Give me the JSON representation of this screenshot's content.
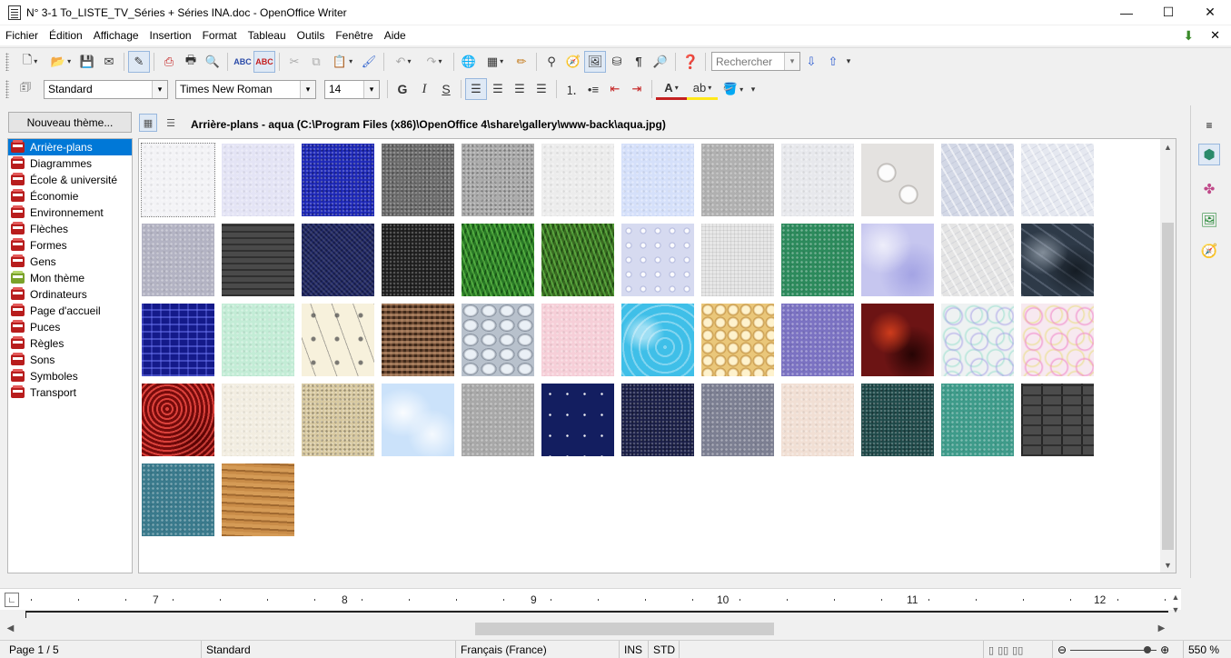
{
  "window": {
    "title": "N° 3-1 To_LISTE_TV_Séries + Séries INA.doc - OpenOffice Writer",
    "minimize": "—",
    "maximize": "☐",
    "close": "✕"
  },
  "menu": {
    "items": [
      "Fichier",
      "Édition",
      "Affichage",
      "Insertion",
      "Format",
      "Tableau",
      "Outils",
      "Fenêtre",
      "Aide"
    ],
    "update_icon": "⬇",
    "close_doc": "✕"
  },
  "toolbar_standard": {
    "search_placeholder": "Rechercher"
  },
  "toolbar_format": {
    "paragraph_style": "Standard",
    "font_name": "Times New Roman",
    "font_size": "14",
    "bold": "G",
    "italic": "I",
    "shadow": "S"
  },
  "gallery": {
    "new_theme_label": "Nouveau thème...",
    "title": "Arrière-plans - aqua (C:\\Program Files (x86)\\OpenOffice 4\\share\\gallery\\www-back\\aqua.jpg)",
    "themes": [
      {
        "label": "Arrière-plans",
        "selected": true
      },
      {
        "label": "Diagrammes"
      },
      {
        "label": "École & université"
      },
      {
        "label": "Économie"
      },
      {
        "label": "Environnement"
      },
      {
        "label": "Flèches"
      },
      {
        "label": "Formes"
      },
      {
        "label": "Gens"
      },
      {
        "label": "Mon thème",
        "green": true
      },
      {
        "label": "Ordinateurs"
      },
      {
        "label": "Page d'accueil"
      },
      {
        "label": "Puces"
      },
      {
        "label": "Règles"
      },
      {
        "label": "Sons"
      },
      {
        "label": "Symboles"
      },
      {
        "label": "Transport"
      }
    ],
    "tiles": [
      {
        "name": "aqua",
        "bg": "#f3f3f6",
        "fx": "speck-light"
      },
      {
        "name": "blizzard",
        "bg": "#e4e4f5",
        "fx": "speck-light"
      },
      {
        "name": "blue-dust",
        "bg": "#1c27b8",
        "fx": "speck-dark"
      },
      {
        "name": "concrete-dark",
        "bg": "#6b6b6b",
        "fx": "speck-dark"
      },
      {
        "name": "concrete-light",
        "bg": "#aaaaaa",
        "fx": "speck-dark"
      },
      {
        "name": "paper-white",
        "bg": "#ececec",
        "fx": "speck-light"
      },
      {
        "name": "ice-blue",
        "bg": "#d5e0fa",
        "fx": "speck-light"
      },
      {
        "name": "grey-sand",
        "bg": "#b0b0b0",
        "fx": "speck-light"
      },
      {
        "name": "clouds-white",
        "bg": "#e7e8ec",
        "fx": "speck-light"
      },
      {
        "name": "paws",
        "bg": "#e4e2e0",
        "fx": "paws"
      },
      {
        "name": "crystal",
        "bg": "#d3d8e6",
        "fx": "streak"
      },
      {
        "name": "frost",
        "bg": "#e5e8f0",
        "fx": "streak"
      },
      {
        "name": "lilac-rough",
        "bg": "#b3b3c3",
        "fx": "speck-light"
      },
      {
        "name": "charcoal",
        "bg": "#4a4a4a",
        "fx": "hline"
      },
      {
        "name": "navy-weave",
        "bg": "#1e2563",
        "fx": "weave"
      },
      {
        "name": "black-grain",
        "bg": "#1f1f1f",
        "fx": "speck-dark"
      },
      {
        "name": "grass",
        "bg": "#2a7a26",
        "fx": "grass"
      },
      {
        "name": "grass-dark",
        "bg": "#3a6b22",
        "fx": "grass"
      },
      {
        "name": "water-drops",
        "bg": "#d6daf0",
        "fx": "drops"
      },
      {
        "name": "canvas-white",
        "bg": "#e7e7e7",
        "fx": "weave-light"
      },
      {
        "name": "green-felt",
        "bg": "#2c8a5c",
        "fx": "speck-light"
      },
      {
        "name": "lavender-marble",
        "bg": "#c6c6ef",
        "fx": "marble"
      },
      {
        "name": "white-marble",
        "bg": "#e4e4e4",
        "fx": "streak"
      },
      {
        "name": "blue-marble",
        "bg": "#2e3a48",
        "fx": "marble-dark"
      },
      {
        "name": "blue-maze",
        "bg": "#141a8a",
        "fx": "maze"
      },
      {
        "name": "mint",
        "bg": "#c3ecd6",
        "fx": "speck-light"
      },
      {
        "name": "music-notes",
        "bg": "#f7f1dc",
        "fx": "notes"
      },
      {
        "name": "basket-weave",
        "bg": "#6a4832",
        "fx": "basket"
      },
      {
        "name": "stones",
        "bg": "#b8c1cc",
        "fx": "stones"
      },
      {
        "name": "pink",
        "bg": "#f6cfd8",
        "fx": "speck-light"
      },
      {
        "name": "pool-water",
        "bg": "#3fbfe8",
        "fx": "water"
      },
      {
        "name": "popcorn",
        "bg": "#eac77a",
        "fx": "popcorn"
      },
      {
        "name": "violet",
        "bg": "#7b72c2",
        "fx": "speck-light"
      },
      {
        "name": "red-lava",
        "bg": "#6c1414",
        "fx": "lava"
      },
      {
        "name": "rings-pastel",
        "bg": "#eef2f2",
        "fx": "rings"
      },
      {
        "name": "rings-pink",
        "bg": "#f7e9f0",
        "fx": "rings-pink"
      },
      {
        "name": "roses",
        "bg": "#a51c1c",
        "fx": "roses"
      },
      {
        "name": "cream",
        "bg": "#f2ede1",
        "fx": "speck-light"
      },
      {
        "name": "sand",
        "bg": "#d8c9a0",
        "fx": "speck-dark"
      },
      {
        "name": "sky",
        "bg": "#cbe2fa",
        "fx": "sky"
      },
      {
        "name": "stucco-grey",
        "bg": "#a8a8a8",
        "fx": "speck-light"
      },
      {
        "name": "starry-night",
        "bg": "#131e60",
        "fx": "stars"
      },
      {
        "name": "navy-stucco",
        "bg": "#1a1f48",
        "fx": "speck-dark"
      },
      {
        "name": "slate-stucco",
        "bg": "#7c7f92",
        "fx": "speck-light"
      },
      {
        "name": "peach",
        "bg": "#f1dfd4",
        "fx": "speck-light"
      },
      {
        "name": "teal-leather",
        "bg": "#1f4a4a",
        "fx": "speck-dark"
      },
      {
        "name": "teal",
        "bg": "#3e9b8a",
        "fx": "speck-light"
      },
      {
        "name": "bricks",
        "bg": "#4c4c4c",
        "fx": "bricks"
      },
      {
        "name": "blue-suede",
        "bg": "#3a7a8c",
        "fx": "speck-light"
      },
      {
        "name": "wood",
        "bg": "#c98c48",
        "fx": "wood"
      }
    ]
  },
  "ruler": {
    "numbers": [
      "7",
      "8",
      "9",
      "10",
      "11",
      "12"
    ]
  },
  "status": {
    "page": "Page 1 / 5",
    "style": "Standard",
    "language": "Français (France)",
    "insert_mode": "INS",
    "selection_mode": "STD",
    "zoom": "550 %"
  },
  "colors": {
    "selection": "#0078d7",
    "theme_icon": "#b81d1d",
    "toolbar_bg": "#f0f0f0"
  }
}
